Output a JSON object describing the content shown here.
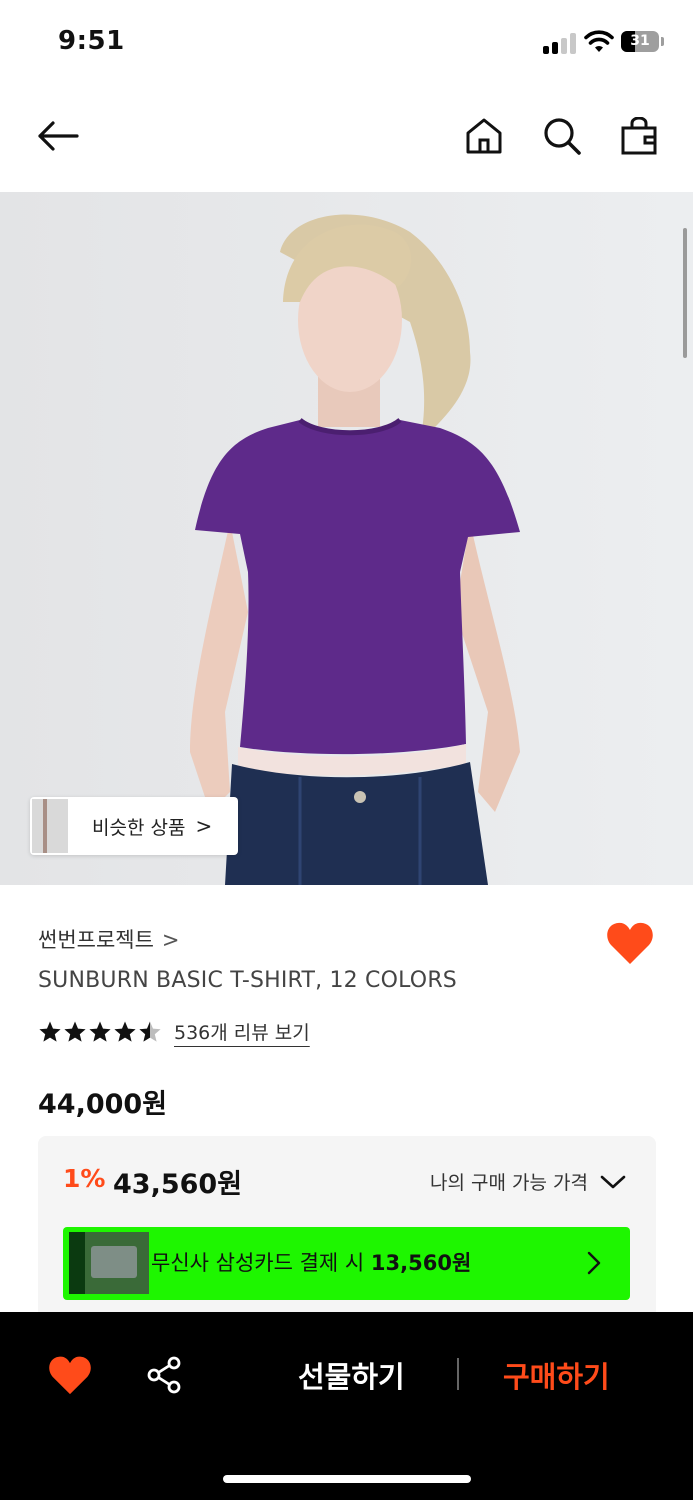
{
  "status": {
    "time": "9:51",
    "battery": "31"
  },
  "nav": {
    "icons": [
      "back-arrow-icon",
      "home-icon",
      "search-icon",
      "shopping-bag-icon"
    ]
  },
  "hero": {
    "similar_label": "비슷한 상품",
    "similar_chevron": ">"
  },
  "product": {
    "brand": "썬번프로젝트",
    "brand_chevron": ">",
    "title": "SUNBURN BASIC T-SHIRT, 12 COLORS",
    "rating": 4.5,
    "review_link": "536개 리뷰 보기",
    "price": "44,000원"
  },
  "panel": {
    "discount_rate": "1%",
    "discount_price": "43,560원",
    "my_price_label": "나의 구매 가능 가격",
    "card_prefix": "무신사 삼성카드 결제 시 ",
    "card_amount": "13,560원"
  },
  "bottom": {
    "gift_label": "선물하기",
    "buy_label": "구매하기"
  },
  "colors": {
    "accent": "#ff4b1a",
    "card_green": "#1ef600",
    "shirt_purple": "#5e2a8a",
    "bar_bg": "#000000"
  }
}
